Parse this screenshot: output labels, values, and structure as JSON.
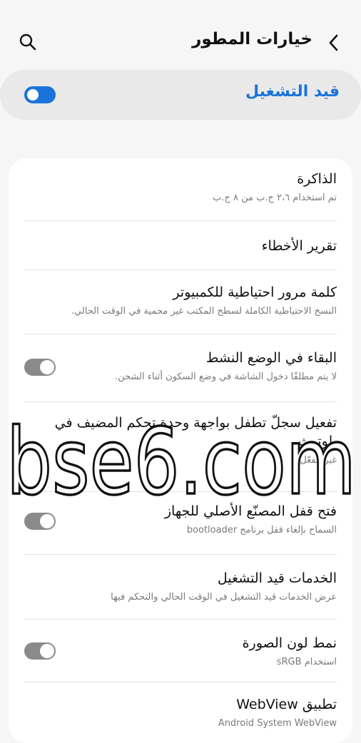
{
  "header": {
    "title": "خيارات المطور",
    "back_icon": "chevron-left-icon",
    "search_icon": "search-icon"
  },
  "master": {
    "label": "قيد التشغيل",
    "enabled": true,
    "accent": "#1a73d9"
  },
  "items": [
    {
      "title": "الذاكرة",
      "subtitle": "تم استخدام ٢،٦ ج.ب من ٨ ج.ب"
    },
    {
      "title": "تقرير الأخطاء",
      "subtitle": ""
    },
    {
      "title": "كلمة مرور احتياطية للكمبيوتر",
      "subtitle": "النسخ الاحتياطية الكاملة لسطح المكتب غير محمية في الوقت الحالي."
    },
    {
      "title": "البقاء في الوضع النشط",
      "subtitle": "لا يتم مطلقًا دخول الشاشة في وضع السكون أثناء الشحن.",
      "toggle": false
    },
    {
      "title": "تفعيل سجلّ تطفل بواجهة وحدة تحكم المضيف في بلوتوث",
      "subtitle": "غير مفعّل"
    },
    {
      "title": "فتح قفل المصنّع الأصلي للجهاز",
      "subtitle": "السماح بإلغاء قفل برنامج bootloader",
      "toggle": false
    },
    {
      "title": "الخدمات قيد التشغيل",
      "subtitle": "عرض الخدمات قيد التشغيل في الوقت الحالي والتحكم فيها"
    },
    {
      "title": "نمط لون الصورة",
      "subtitle": "استخدام sRGB",
      "toggle": false
    },
    {
      "title": "تطبيق WebView",
      "subtitle": "Android System WebView"
    }
  ],
  "watermark": {
    "text": "bse6.com"
  }
}
